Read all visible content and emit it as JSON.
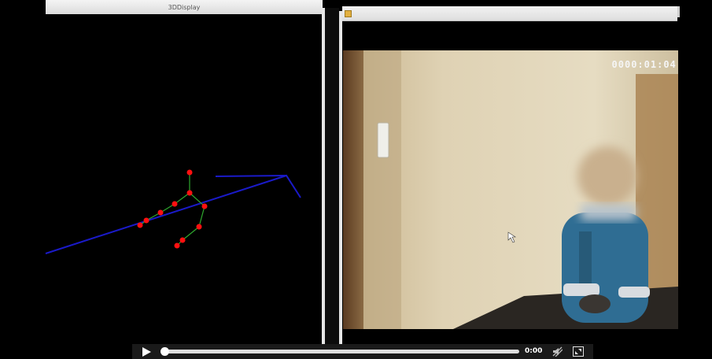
{
  "window_3d": {
    "title": "3DDisplay"
  },
  "video": {
    "timecode": "0000:01:04.",
    "progress": 0.0
  },
  "controls": {
    "time": "0:00",
    "play_icon": "play-icon",
    "mute_icon": "mute-icon",
    "fullscreen_icon": "fullscreen-icon"
  },
  "colors": {
    "background": "#000000",
    "skeleton_joint": "#ff0000",
    "skeleton_bone": "#2ea82e",
    "axis_line": "#1a1ac8",
    "window_chrome": "#e6e6e6"
  }
}
